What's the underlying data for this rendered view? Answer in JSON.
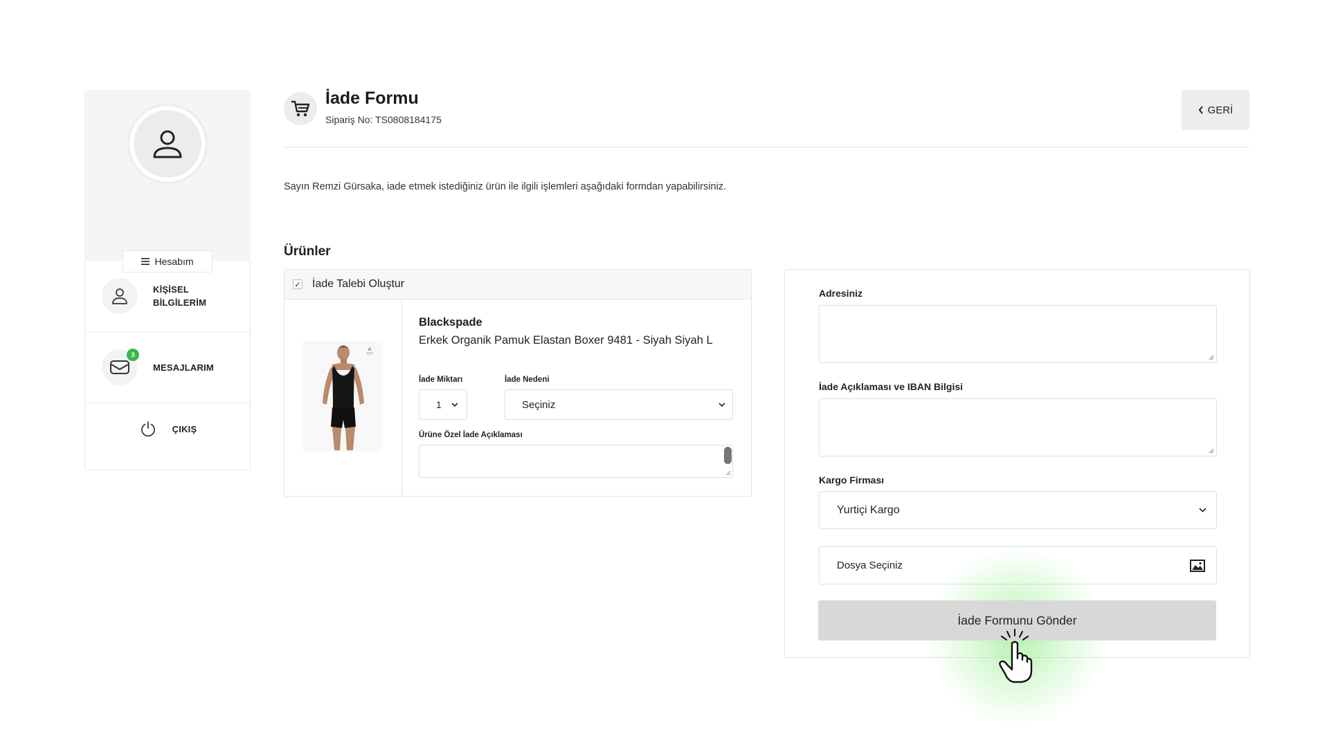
{
  "sidebar": {
    "account_label": "Hesabım",
    "items": [
      {
        "label_line1": "KİŞİSEL",
        "label_line2": "BİLGİLERİM",
        "icon": "user-icon"
      },
      {
        "label": "MESAJLARIM",
        "icon": "mail-icon",
        "badge": "3"
      },
      {
        "label": "ÇIKIŞ",
        "icon": "power-icon"
      }
    ]
  },
  "header": {
    "title": "İade Formu",
    "order_no": "Sipariş No: TS0808184175",
    "back_label": "GERİ"
  },
  "intro": "Sayın Remzi Gürsaka, iade etmek istediğiniz ürün ile ilgili işlemleri aşağıdaki formdan yapabilirsiniz.",
  "products": {
    "title": "Ürünler",
    "create_request_label": "İade Talebi Oluştur",
    "create_request_checked": true,
    "item": {
      "brand": "Blackspade",
      "name": "Erkek Organik Pamuk Elastan Boxer 9481 - Siyah Siyah L",
      "qty_label": "İade Miktarı",
      "qty_value": "1",
      "reason_label": "İade Nedeni",
      "reason_value": "Seçiniz",
      "note_label": "Ürüne Özel İade Açıklaması",
      "note_value": ""
    }
  },
  "form": {
    "address_label": "Adresiniz",
    "address_value": "",
    "iban_label": "İade Açıklaması ve IBAN Bilgisi",
    "iban_value": "",
    "cargo_label": "Kargo Firması",
    "cargo_value": "Yurtiçi Kargo",
    "file_label": "Dosya Seçiniz",
    "submit_label": "İade Formunu Gönder"
  },
  "colors": {
    "badge": "#3bb64a",
    "submit_bg": "#d8d8d8",
    "sidebar_bg": "#f5f5f5"
  }
}
